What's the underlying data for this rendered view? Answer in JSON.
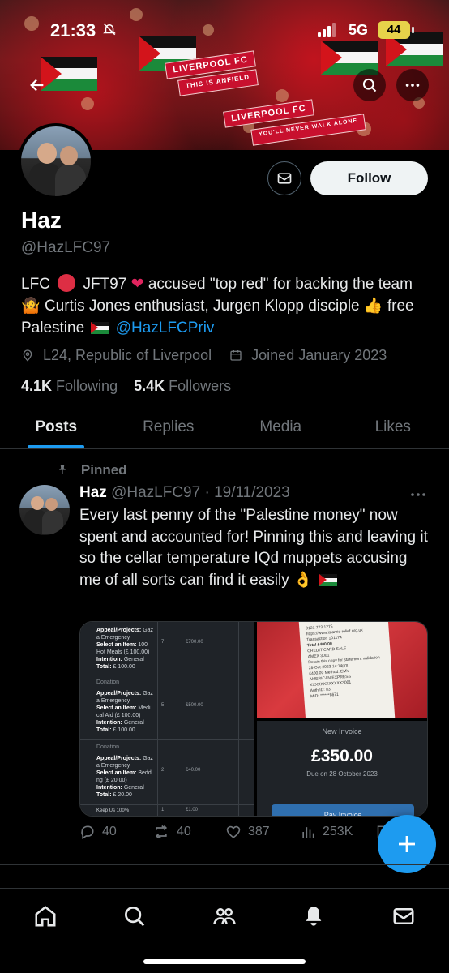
{
  "status_bar": {
    "time": "21:33",
    "network": "5G",
    "battery": "44"
  },
  "banner": {
    "scarf_1": "LIVERPOOL FC",
    "scarf_2": "THIS IS ANFIELD",
    "scarf_3": "LIVERPOOL FC",
    "scarf_4": "YOU'LL NEVER WALK ALONE"
  },
  "profile": {
    "name": "Haz",
    "handle": "@HazLFC97",
    "follow_label": "Follow",
    "bio_part1": "LFC",
    "bio_part2": "JFT97",
    "bio_part3": "accused \"top red\" for backing the team",
    "bio_part4": "Curtis Jones enthusiast, Jurgen Klopp disciple",
    "bio_part5": "free Palestine",
    "bio_link": "@HazLFCPriv",
    "location": "L24, Republic of Liverpool",
    "joined": "Joined January 2023",
    "following_count": "4.1K",
    "following_label": "Following",
    "followers_count": "5.4K",
    "followers_label": "Followers"
  },
  "tabs": [
    {
      "label": "Posts"
    },
    {
      "label": "Replies"
    },
    {
      "label": "Media"
    },
    {
      "label": "Likes"
    }
  ],
  "tweet": {
    "pinned_label": "Pinned",
    "name": "Haz",
    "handle_date": "@HazLFC97 · 19/11/2023",
    "text": "Every last penny of the \"Palestine money\" now spent and accounted for! Pinning this and leaving it so the cellar temperature IQd muppets accusing me of all sorts can find it easily",
    "replies": "40",
    "retweets": "40",
    "likes": "387",
    "views": "253K"
  },
  "media": {
    "rows": [
      {
        "appeal": "Appeal/Projects:",
        "appeal_val": "Gaz a Emergency",
        "item": "Select an Item:",
        "item_val": "100 Hot Meals (£ 100.00)",
        "intention": "Intention:",
        "intention_val": "General",
        "total": "Total:",
        "total_val": "£ 100.00",
        "qty": "7",
        "amount": "£700.00"
      },
      {
        "appeal": "Appeal/Projects:",
        "appeal_val": "Gaz a Emergency",
        "item": "Select an Item:",
        "item_val": "Medi cal Aid (£ 100.00)",
        "intention": "Intention:",
        "intention_val": "General",
        "total": "Total:",
        "total_val": "£ 100.00",
        "qty": "5",
        "amount": "£500.00"
      },
      {
        "appeal": "Appeal/Projects:",
        "appeal_val": "Gaz a Emergency",
        "item": "Select an Item:",
        "item_val": "Beddi ng (£ 20.00)",
        "intention": "Intention:",
        "intention_val": "General",
        "total": "Total:",
        "total_val": "£ 20.00",
        "qty": "2",
        "amount": "£40.00"
      }
    ],
    "donation_label": "Donation",
    "keep_us": "Keep Us 100%",
    "keep_qty": "1",
    "keep_amt": "£1.00",
    "receipt_lines": [
      "0121 773 1275",
      "https://www.islamic-relief.org.uk",
      "Transaction 101174",
      "Total £400.00",
      "CREDIT CARD SALE",
      "AMEX 3001",
      "Retain this copy for statement validation",
      "28-Oct-2023 14:14pm",
      "£400.00 Method: EMV",
      "AMERICAN EXPRESS",
      "XXXXXXXXXXXX3001",
      "Auth ID: 83",
      "MID: ******8671"
    ],
    "invoice_title": "New Invoice",
    "invoice_amount": "£350.00",
    "invoice_due": "Due on 28 October 2023",
    "pay_label": "Pay Invoice"
  }
}
